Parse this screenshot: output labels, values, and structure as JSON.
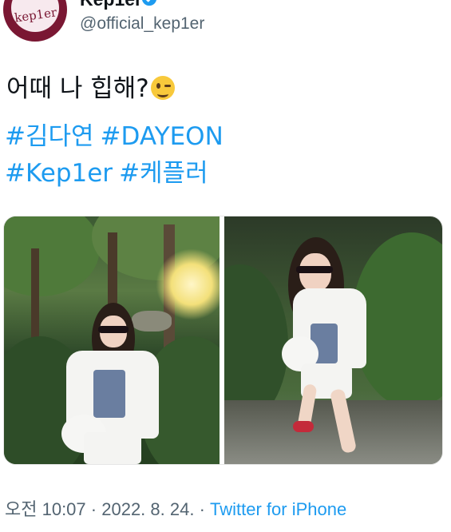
{
  "tweet": {
    "display_name": "Kep1er",
    "handle": "@official_kep1er",
    "avatar_text": "kep1er",
    "text": "어때 나 힙해?",
    "emoji": "winking-face-emoji",
    "hashtags": [
      "#김다연",
      "#DAYEON",
      "#Kep1er",
      "#케플러"
    ],
    "time": "오전 10:07",
    "separator": "·",
    "date": "2022. 8. 24.",
    "source": "Twitter for iPhone"
  },
  "colors": {
    "link": "#1d9bf0",
    "secondary_text": "#536471",
    "primary_text": "#0f1419",
    "avatar_bg": "#7a1733"
  }
}
